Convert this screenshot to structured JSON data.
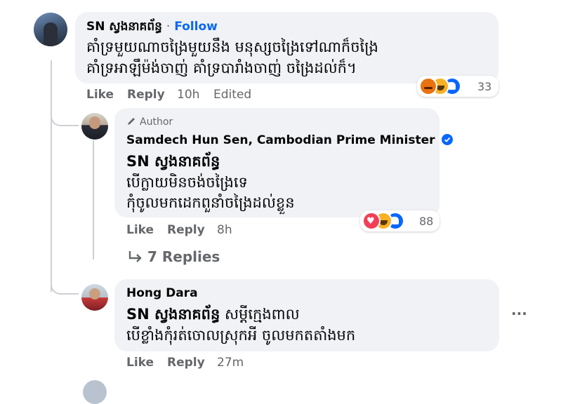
{
  "comments": [
    {
      "author": "SN ស្វងនាគព័ន្ធ",
      "separator": "·",
      "follow_label": "Follow",
      "lines": [
        "គាំទ្រមួយណាចង្រៃមួយនឹង មនុស្សចង្រៃទៅណាក៏ចង្រៃ",
        "គាំទ្រអាឡឹម៉ង់ចាញ់ គាំទ្របារាំងចាញ់ ចង្រៃដល់ក៏។"
      ],
      "like": "Like",
      "reply": "Reply",
      "time": "10h",
      "edited": "Edited",
      "reaction_count": "33",
      "reactions": [
        "angry-icon",
        "haha-icon",
        "like-icon"
      ]
    },
    {
      "author_badge": "Author",
      "author": "Samdech Hun Sen, Cambodian Prime Minister",
      "mention": "SN ស្វងនាគព័ន្ធ",
      "lines": [
        "បើក្លាយមិនចង់ចង្រៃទេ",
        "កុំចូលមកដេកពួនាំចង្រៃដល់ខ្លួន"
      ],
      "like": "Like",
      "reply": "Reply",
      "time": "8h",
      "reaction_count": "88",
      "reactions": [
        "love-icon",
        "haha-icon",
        "like-icon"
      ],
      "replies_label": "7 Replies"
    },
    {
      "author": "Hong Dara",
      "mention": "SN ស្វងនាគព័ន្ធ",
      "line1_rest": " សម្ដីក្មេងពាល",
      "line2": "បើខ្លាំងកុំរត់ចោលស្រុកអី ចូលមកតតាំងមក",
      "like": "Like",
      "reply": "Reply",
      "time": "27m",
      "more_label": "···"
    }
  ],
  "colors": {
    "bubble": "#f0f2f5",
    "follow": "#0866ff",
    "secondary_text": "#65676b",
    "verified": "#0866ff",
    "thread_line": "#ced0d4"
  }
}
